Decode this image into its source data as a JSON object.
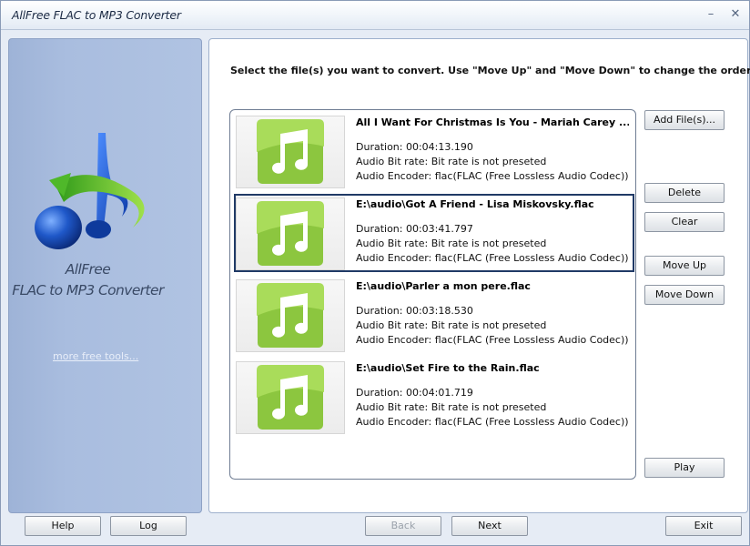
{
  "window": {
    "title": "AllFree FLAC to MP3 Converter",
    "minimize": "–",
    "close": "✕"
  },
  "sidebar": {
    "name_line1": "AllFree",
    "name_line2": "FLAC to MP3 Converter",
    "more_link": "more free tools..."
  },
  "main": {
    "instruction": "Select the file(s) you want to convert. Use \"Move Up\" and \"Move Down\" to change the order.",
    "files": [
      {
        "name": "All I Want For Christmas Is You - Mariah Carey ...",
        "duration": "Duration: 00:04:13.190",
        "bitrate": "Audio Bit rate: Bit rate is not preseted",
        "encoder": "Audio Encoder: flac(FLAC (Free Lossless Audio Codec))"
      },
      {
        "name": "E:\\audio\\Got A Friend - Lisa Miskovsky.flac",
        "duration": "Duration: 00:03:41.797",
        "bitrate": "Audio Bit rate: Bit rate is not preseted",
        "encoder": "Audio Encoder: flac(FLAC (Free Lossless Audio Codec))"
      },
      {
        "name": "E:\\audio\\Parler a mon pere.flac",
        "duration": "Duration: 00:03:18.530",
        "bitrate": "Audio Bit rate: Bit rate is not preseted",
        "encoder": "Audio Encoder: flac(FLAC (Free Lossless Audio Codec))"
      },
      {
        "name": "E:\\audio\\Set Fire to the Rain.flac",
        "duration": "Duration: 00:04:01.719",
        "bitrate": "Audio Bit rate: Bit rate is not preseted",
        "encoder": "Audio Encoder: flac(FLAC (Free Lossless Audio Codec))"
      }
    ],
    "buttons": {
      "add_files": "Add File(s)...",
      "delete": "Delete",
      "clear": "Clear",
      "move_up": "Move Up",
      "move_down": "Move Down",
      "play": "Play"
    }
  },
  "footer": {
    "help": "Help",
    "log": "Log",
    "back": "Back",
    "next": "Next",
    "exit": "Exit"
  },
  "colors": {
    "selection_border": "#203a66",
    "note_green": "#8cc63f",
    "sidebar_blue": "#a9bddf"
  }
}
